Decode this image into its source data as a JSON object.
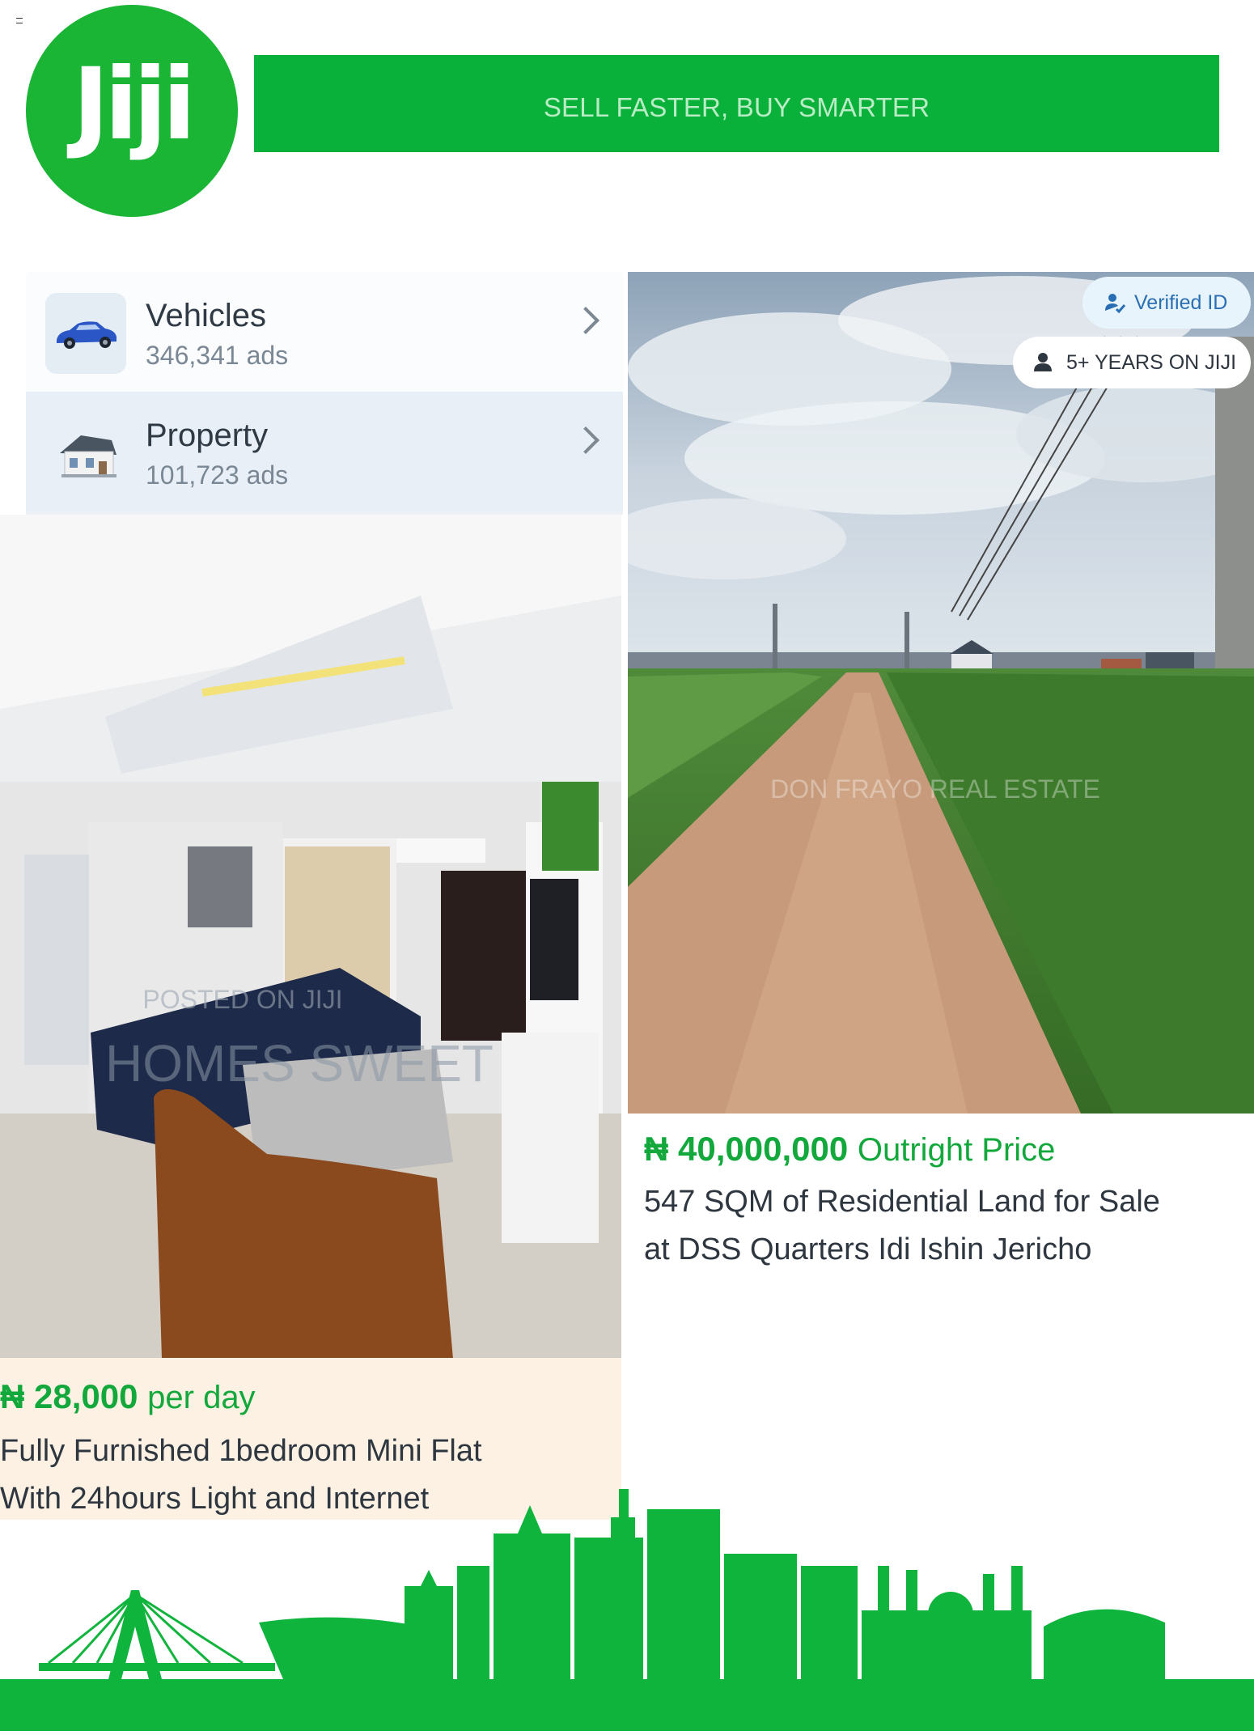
{
  "brand": {
    "logo_text": "Jiji",
    "tagline": "SELL FASTER, BUY SMARTER",
    "colors": {
      "primary": "#1bb535",
      "banner": "#09b13a",
      "price": "#12a83b"
    }
  },
  "categories": [
    {
      "name": "Vehicles",
      "count": "346,341 ads",
      "icon": "car-icon"
    },
    {
      "name": "Property",
      "count": "101,723 ads",
      "icon": "house-icon"
    }
  ],
  "listings": {
    "left": {
      "price": "₦ 28,000",
      "price_unit": "per day",
      "title_line1": "Fully Furnished 1bedroom Mini Flat",
      "title_line2": "With 24hours Light and Internet",
      "watermark_line1": "POSTED ON JIJI",
      "watermark_line2": "HOMES SWEET"
    },
    "right": {
      "price": "₦ 40,000,000",
      "price_unit": "Outright Price",
      "title_line1": "547 SQM of Residential Land for Sale",
      "title_line2": "at DSS Quarters Idi Ishin Jericho",
      "watermark": "DON FRAYO REAL ESTATE",
      "badges": {
        "verified": "Verified ID",
        "years": "5+ YEARS ON JIJI"
      }
    }
  }
}
